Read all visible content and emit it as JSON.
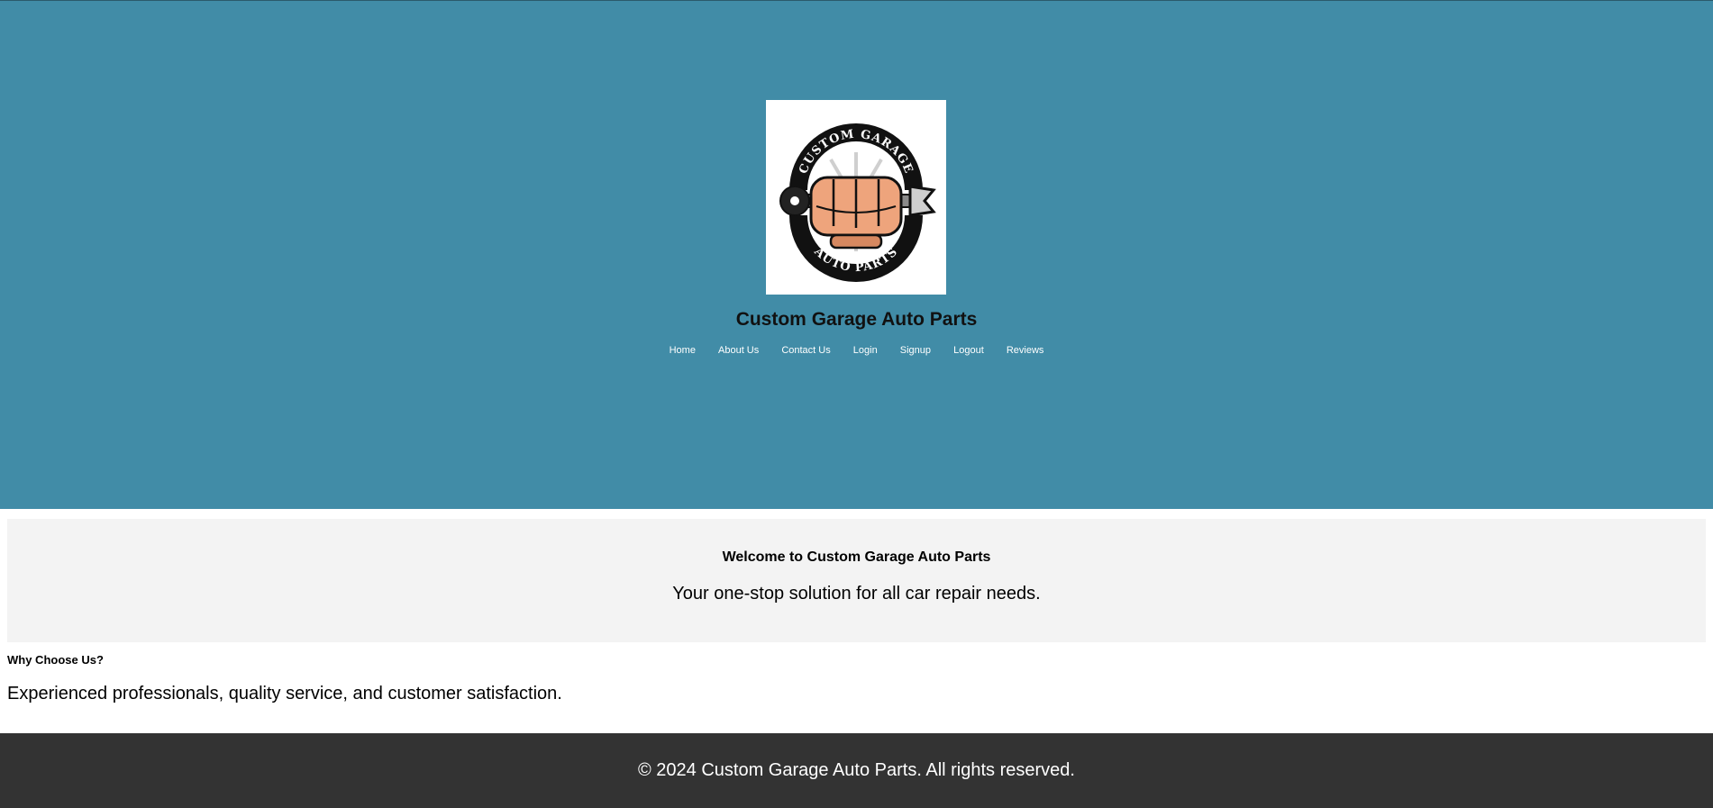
{
  "header": {
    "logo_icon": "custom-garage-fist-wrench-logo",
    "logo_text_top": "CUSTOM GARAGE",
    "logo_text_bottom": "AUTO PARTS",
    "title": "Custom Garage Auto Parts",
    "nav": [
      {
        "label": "Home"
      },
      {
        "label": "About Us"
      },
      {
        "label": "Contact Us"
      },
      {
        "label": "Login"
      },
      {
        "label": "Signup"
      },
      {
        "label": "Logout"
      },
      {
        "label": "Reviews"
      }
    ]
  },
  "welcome": {
    "heading": "Welcome to Custom Garage Auto Parts",
    "tagline": "Your one-stop solution for all car repair needs."
  },
  "why": {
    "heading": "Why Choose Us?",
    "text": "Experienced professionals, quality service, and customer satisfaction."
  },
  "footer": {
    "text": "© 2024 Custom Garage Auto Parts. All rights reserved."
  },
  "colors": {
    "header_bg": "#418ca7",
    "welcome_bg": "#f3f3f3",
    "footer_bg": "#333333"
  }
}
